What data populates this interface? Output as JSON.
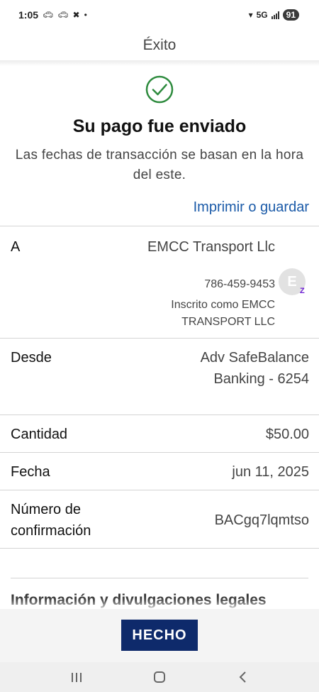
{
  "status_bar": {
    "time": "1:05",
    "icons": [
      "car-icon",
      "car-icon",
      "sync-off-icon",
      "dot-icon"
    ],
    "network": "5G",
    "battery": "91"
  },
  "header": {
    "title": "Éxito"
  },
  "success": {
    "icon": "check-circle-icon",
    "headline": "Su pago fue enviado",
    "subtitle": "Las fechas de transacción se basan en la hora del este.",
    "print_link": "Imprimir o guardar"
  },
  "recipient": {
    "label": "A",
    "name": "EMCC Transport Llc",
    "phone": "786-459-9453",
    "enrolled": "Inscrito como EMCC TRANSPORT LLC",
    "avatar_initial": "E",
    "badge": "Z"
  },
  "from": {
    "label": "Desde",
    "value": "Adv SafeBalance Banking - 6254"
  },
  "amount": {
    "label": "Cantidad",
    "value": "$50.00"
  },
  "date": {
    "label": "Fecha",
    "value": "jun 11, 2025"
  },
  "confirmation": {
    "label": "Número de confirmación",
    "value": "BACgq7lqmtso"
  },
  "legal": {
    "title": "Información y divulgaciones legales"
  },
  "footer": {
    "done_label": "HECHO"
  },
  "colors": {
    "accent": "#1a5aa8",
    "button": "#0e2a6b",
    "success": "#2e8b3e",
    "zelle": "#6d1ed4"
  }
}
